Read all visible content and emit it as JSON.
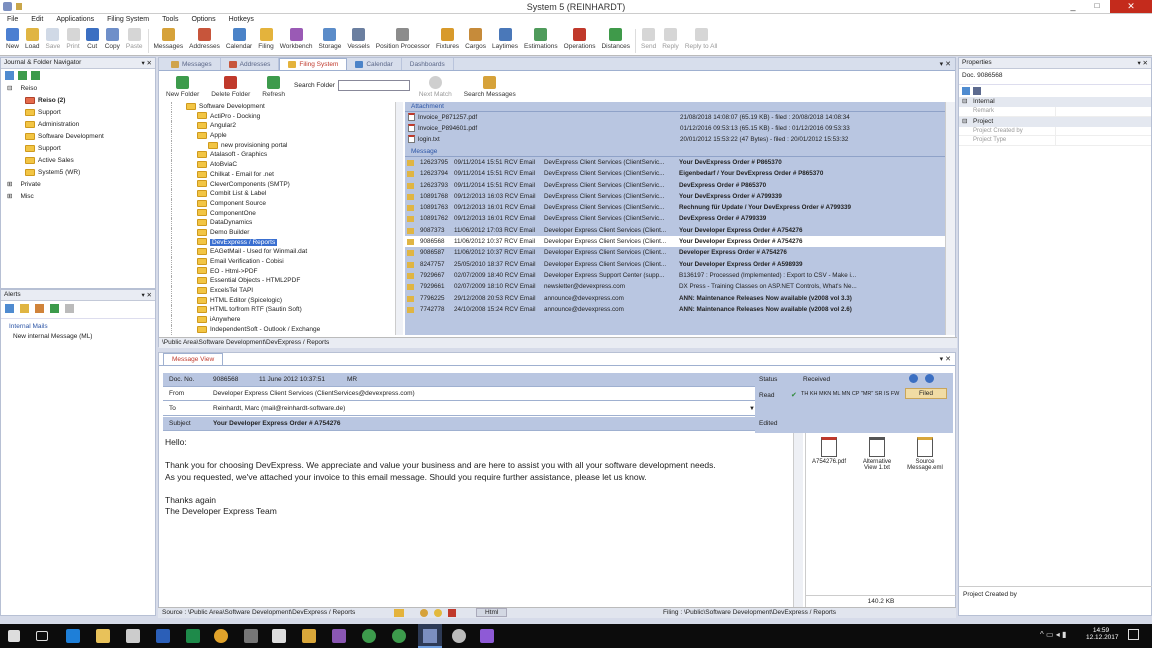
{
  "window": {
    "title": "System 5 (REINHARDT)",
    "minimize": "_",
    "maximize": "□",
    "close": "✕"
  },
  "menu": [
    "File",
    "Edit",
    "Applications",
    "Filing System",
    "Tools",
    "Options",
    "Hotkeys"
  ],
  "toolbar": [
    {
      "label": "New",
      "color": "#4c7fd1"
    },
    {
      "label": "Load",
      "color": "#e0b543"
    },
    {
      "label": "Save",
      "color": "#8aa0c0",
      "disabled": true
    },
    {
      "label": "Print",
      "color": "#999",
      "disabled": true
    },
    {
      "label": "Cut",
      "color": "#3b6fc2"
    },
    {
      "label": "Copy",
      "color": "#6f8fc9"
    },
    {
      "label": "Paste",
      "color": "#999",
      "disabled": true
    },
    {
      "label": "Messages",
      "color": "#d6a23a"
    },
    {
      "label": "Addresses",
      "color": "#c7553b"
    },
    {
      "label": "Calendar",
      "color": "#4b83c8"
    },
    {
      "label": "Filing",
      "color": "#e4b33c"
    },
    {
      "label": "Workbench",
      "color": "#9a5ab5"
    },
    {
      "label": "Storage",
      "color": "#5b8cc9"
    },
    {
      "label": "Vessels",
      "color": "#6b7fa0"
    },
    {
      "label": "Position Processor",
      "color": "#8c8c8c"
    },
    {
      "label": "Fixtures",
      "color": "#d89a2b"
    },
    {
      "label": "Cargos",
      "color": "#c68b3a"
    },
    {
      "label": "Laytimes",
      "color": "#4a78b9"
    },
    {
      "label": "Estimations",
      "color": "#4f9b5b"
    },
    {
      "label": "Operations",
      "color": "#c0392b"
    },
    {
      "label": "Distances",
      "color": "#3f9a4a"
    },
    {
      "label": "Send",
      "color": "#999",
      "disabled": true
    },
    {
      "label": "Reply",
      "color": "#999",
      "disabled": true
    },
    {
      "label": "Reply to All",
      "color": "#999",
      "disabled": true
    }
  ],
  "nav": {
    "title": "Journal & Folder Navigator",
    "items": [
      {
        "label": "Reiso",
        "level": 0,
        "exp": "⊟"
      },
      {
        "label": "Reiso (2)",
        "level": 1,
        "red": true,
        "bold": true
      },
      {
        "label": "Support",
        "level": 1
      },
      {
        "label": "Administration",
        "level": 1
      },
      {
        "label": "Software Development",
        "level": 1
      },
      {
        "label": "Support",
        "level": 1
      },
      {
        "label": "Active Sales",
        "level": 1
      },
      {
        "label": "System5 (WR)",
        "level": 1
      },
      {
        "label": "Private",
        "level": 0,
        "exp": "⊞"
      },
      {
        "label": "Misc",
        "level": 0,
        "exp": "⊞"
      }
    ]
  },
  "alerts": {
    "title": "Alerts",
    "internal": "Internal Mails",
    "message": "New internal Message (ML)"
  },
  "properties": {
    "title": "Properties",
    "doc": "Doc. 9086568",
    "groups": [
      {
        "name": "Internal",
        "fields": [
          "Remark"
        ]
      },
      {
        "name": "Project",
        "fields": [
          "Project Created by",
          "Project Type"
        ]
      }
    ],
    "footer": "Project Created by"
  },
  "tabs": [
    "Messages",
    "Addresses",
    "Filing System",
    "Calendar",
    "Dashboards"
  ],
  "subtoolbar": {
    "new_folder": "New Folder",
    "delete_folder": "Delete Folder",
    "refresh": "Refresh",
    "search_label": "Search Folder",
    "next_match": "Next Match",
    "search_messages": "Search Messages"
  },
  "folders": [
    {
      "label": "Software Development",
      "level": 0
    },
    {
      "label": "ActiPro - Docking",
      "level": 1
    },
    {
      "label": "Angular2",
      "level": 1
    },
    {
      "label": "Apple",
      "level": 1
    },
    {
      "label": "new provisioning portal",
      "level": 2
    },
    {
      "label": "Atalasoft - Graphics",
      "level": 1
    },
    {
      "label": "AtoBviaC",
      "level": 1
    },
    {
      "label": "Chilkat - Email for .net",
      "level": 1
    },
    {
      "label": "CleverComponents (SMTP)",
      "level": 1
    },
    {
      "label": "Combit List & Label",
      "level": 1
    },
    {
      "label": "Component Source",
      "level": 1
    },
    {
      "label": "ComponentOne",
      "level": 1
    },
    {
      "label": "DataDynamics",
      "level": 1
    },
    {
      "label": "Demo Builder",
      "level": 1
    },
    {
      "label": "DevExpress / Reports",
      "level": 1,
      "sel": true
    },
    {
      "label": "EAGetMail - Used for Winmail.dat",
      "level": 1
    },
    {
      "label": "Email Verification - Cobisi",
      "level": 1
    },
    {
      "label": "EO - Html->PDF",
      "level": 1
    },
    {
      "label": "Essential Objects - HTML2PDF",
      "level": 1
    },
    {
      "label": "ExcelsTel TAPI",
      "level": 1
    },
    {
      "label": "HTML Editor (Spicelogic)",
      "level": 1
    },
    {
      "label": "HTML to/from RTF (Sautin Soft)",
      "level": 1
    },
    {
      "label": "iAnywhere",
      "level": 1
    },
    {
      "label": "IndependentSoft - Outlook / Exchange",
      "level": 1
    }
  ],
  "attachments": {
    "header": "Attachment",
    "items": [
      {
        "name": "Invoice_P871257.pdf",
        "info": "21/08/2018 14:08:07 (65.19 KB) - filed : 20/08/2018 14:08:34"
      },
      {
        "name": "Invoice_P894601.pdf",
        "info": "01/12/2016 09:53:13 (65.15 KB) - filed : 01/12/2016 09:53:33"
      },
      {
        "name": "login.txt",
        "info": "20/01/2012 15:53:22 (47 Bytes) - filed : 20/01/2012 15:53:32"
      }
    ]
  },
  "messages": {
    "header": "Message",
    "rows": [
      {
        "id": "12623795",
        "date": "09/11/2014 15:51 RCV Email",
        "from": "DevExpress Client Services (ClientServic...",
        "subject": "Your DevExpress Order # P865370",
        "bold": true
      },
      {
        "id": "12623794",
        "date": "09/11/2014 15:51 RCV Email",
        "from": "DevExpress Client Services (ClientServic...",
        "subject": "Eigenbedarf / Your DevExpress Order # P865370",
        "bold": true
      },
      {
        "id": "12623793",
        "date": "09/11/2014 15:51 RCV Email",
        "from": "DevExpress Client Services (ClientServic...",
        "subject": "DevExpress Order # P865370",
        "bold": true
      },
      {
        "id": "10891768",
        "date": "09/12/2013 16:03 RCV Email",
        "from": "DevExpress Client Services (ClientServic...",
        "subject": "Your DevExpress Order # A799339",
        "bold": true
      },
      {
        "id": "10891763",
        "date": "09/12/2013 16:01 RCV Email",
        "from": "DevExpress Client Services (ClientServic...",
        "subject": "Rechnung für Update / Your DevExpress Order # A799339",
        "bold": true
      },
      {
        "id": "10891762",
        "date": "09/12/2013 16:01 RCV Email",
        "from": "DevExpress Client Services (ClientServic...",
        "subject": "DevExpress Order # A799339",
        "bold": true
      },
      {
        "id": "9087373",
        "date": "11/06/2012 17:03 RCV Email",
        "from": "Developer Express Client Services (Client...",
        "subject": "Your Developer Express Order # A754276",
        "bold": true
      },
      {
        "id": "9086568",
        "date": "11/06/2012 10:37 RCV Email",
        "from": "Developer Express Client Services (Client...",
        "subject": "Your Developer Express Order # A754276",
        "bold": true,
        "sel": true
      },
      {
        "id": "9086587",
        "date": "11/06/2012 10:37 RCV Email",
        "from": "Developer Express Client Services (Client...",
        "subject": "Developer Express Order # A754276",
        "bold": true
      },
      {
        "id": "8247757",
        "date": "25/05/2010 18:37 RCV Email",
        "from": "Developer Express Client Services (Client...",
        "subject": "Your Developer Express Order # A598939",
        "bold": true
      },
      {
        "id": "7929667",
        "date": "02/07/2009 18:40 RCV Email",
        "from": "Developer Express Support Center (supp...",
        "subject": "B136197 : Processed (Implemented) : Export to CSV - Make i...",
        "bold": false
      },
      {
        "id": "7929661",
        "date": "02/07/2009 18:10 RCV Email",
        "from": "newsletter@devexpress.com",
        "subject": "DX Press - Training Classes on ASP.NET Controls, What's Ne...",
        "bold": false
      },
      {
        "id": "7796225",
        "date": "29/12/2008 20:53 RCV Email",
        "from": "announce@devexpress.com",
        "subject": "ANN: Maintenance Releases Now available (v2008 vol 3.3)",
        "bold": true
      },
      {
        "id": "7742778",
        "date": "24/10/2008 15:24 RCV Email",
        "from": "announce@devexpress.com",
        "subject": "ANN: Maintenance Releases Now available (v2008 vol 2.6)",
        "bold": true
      }
    ]
  },
  "path": "\\Public Area\\Software Development\\DevExpress / Reports",
  "msgview": {
    "tab": "Message View",
    "doc_label": "Doc. No.",
    "doc_no": "9086568",
    "date": "11 June 2012 10:37:51",
    "initials": "MR",
    "from_label": "From",
    "from": "Developer Express Client Services (ClientServices@devexpress.com)",
    "to_label": "To",
    "to": "Reinhardt, Marc (mail@reinhardt-software.de)",
    "subject_label": "Subject",
    "subject": "Your Developer Express Order # A754276",
    "status_label": "Status",
    "status": "Received",
    "read_label": "Read",
    "read": "TH KH MKN ML MN CP \"MR\" SR IS FW",
    "filed": "Filed",
    "edited_label": "Edited",
    "body": [
      "Hello:",
      "",
      "Thank you for choosing DevExpress. We appreciate and value your business and are here to assist you with all your software development needs.",
      "As you requested, we've attached your invoice to this email message. Should you require further assistance, please let us know.",
      "",
      "Thanks again",
      "The Developer Express Team"
    ],
    "files": [
      {
        "name": "A754276.pdf"
      },
      {
        "name": "Alternative View 1.txt"
      },
      {
        "name": "Source Message.eml"
      }
    ],
    "size": "140.2 KB"
  },
  "status": {
    "source": "Source : \\Public Area\\Software Development\\DevExpress / Reports",
    "html": "Html",
    "filing": "Filing : \\Public\\Software Development\\DevExpress / Reports"
  },
  "taskbar": {
    "time": "14:59",
    "date": "12.12.2017"
  }
}
